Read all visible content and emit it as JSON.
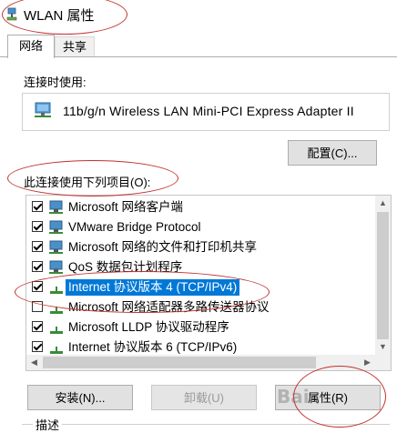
{
  "window": {
    "title": "WLAN 属性"
  },
  "tabs": [
    {
      "label": "网络",
      "active": true
    },
    {
      "label": "共享",
      "active": false
    }
  ],
  "connect_using": {
    "label": "连接时使用:",
    "adapter": "11b/g/n  Wireless LAN Mini-PCI Express Adapter II",
    "configure_button": "配置(C)..."
  },
  "items_section": {
    "label": "此连接使用下列项目(O):",
    "items": [
      {
        "text": "Microsoft 网络客户端",
        "checked": true,
        "selected": false,
        "icon": "network-client-icon"
      },
      {
        "text": "VMware Bridge Protocol",
        "checked": true,
        "selected": false,
        "icon": "network-service-icon"
      },
      {
        "text": "Microsoft 网络的文件和打印机共享",
        "checked": true,
        "selected": false,
        "icon": "network-service-icon"
      },
      {
        "text": "QoS 数据包计划程序",
        "checked": true,
        "selected": false,
        "icon": "network-service-icon"
      },
      {
        "text": "Internet 协议版本 4 (TCP/IPv4)",
        "checked": true,
        "selected": true,
        "icon": "protocol-icon"
      },
      {
        "text": "Microsoft 网络适配器多路传送器协议",
        "checked": false,
        "selected": false,
        "icon": "protocol-icon"
      },
      {
        "text": "Microsoft LLDP 协议驱动程序",
        "checked": true,
        "selected": false,
        "icon": "protocol-icon"
      },
      {
        "text": "Internet 协议版本 6 (TCP/IPv6)",
        "checked": true,
        "selected": false,
        "icon": "protocol-icon"
      }
    ]
  },
  "buttons": {
    "install": "安装(N)...",
    "uninstall": "卸载(U)",
    "properties": "属性(R)"
  },
  "description": {
    "label": "描述"
  },
  "watermark": "Bai",
  "colors": {
    "selection": "#0078d7",
    "annotation": "#c0322f",
    "button_face": "#e1e1e1"
  }
}
